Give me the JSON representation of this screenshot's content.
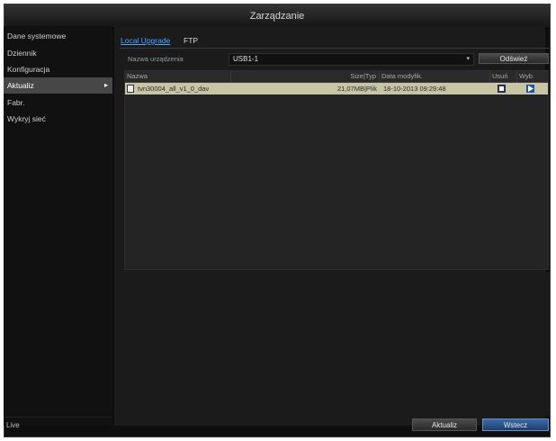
{
  "window": {
    "title": "Zarządzanie"
  },
  "sidebar": {
    "items": [
      {
        "label": "Dane systemowe"
      },
      {
        "label": "Dziennik"
      },
      {
        "label": "Konfiguracja"
      },
      {
        "label": "Aktualiz",
        "active": true
      },
      {
        "label": "Fabr."
      },
      {
        "label": "Wykryj sieć"
      }
    ],
    "footer": "Live"
  },
  "tabs": [
    {
      "label": "Local Upgrade",
      "active": true
    },
    {
      "label": "FTP",
      "active": false
    }
  ],
  "device": {
    "label": "Nazwa urządzenia",
    "value": "USB1-1",
    "refresh_label": "Odśwież"
  },
  "table": {
    "columns": [
      "Nazwa",
      "Size|Typ",
      "Data modyfik.",
      "Usuń",
      "Wyb."
    ],
    "rows": [
      {
        "name": "tvn30004_all_v1_0_dav",
        "size_type": "21,07MB|Plik",
        "date": "18-10-2013 09:29:48"
      }
    ]
  },
  "footer": {
    "update_label": "Aktualiz",
    "exit_label": "Wstecz"
  },
  "colors": {
    "accent": "#4ea7ff",
    "selected_row": "#c8c4a6",
    "action_icon": "#1f56a6"
  }
}
